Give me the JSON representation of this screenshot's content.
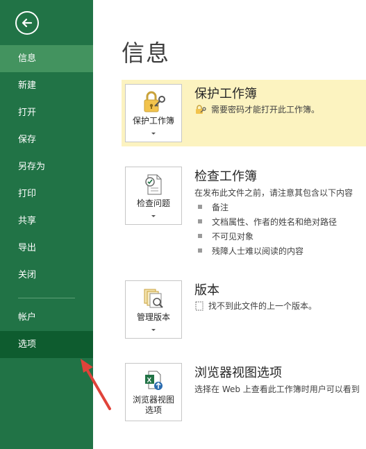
{
  "sidebar": {
    "items": [
      {
        "label": "信息"
      },
      {
        "label": "新建"
      },
      {
        "label": "打开"
      },
      {
        "label": "保存"
      },
      {
        "label": "另存为"
      },
      {
        "label": "打印"
      },
      {
        "label": "共享"
      },
      {
        "label": "导出"
      },
      {
        "label": "关闭"
      },
      {
        "label": "帐户"
      },
      {
        "label": "选项"
      }
    ]
  },
  "main": {
    "title": "信息",
    "protect": {
      "button_label": "保护工作簿",
      "title": "保护工作簿",
      "text": "需要密码才能打开此工作簿。"
    },
    "inspect": {
      "button_label": "检查问题",
      "title": "检查工作簿",
      "text": "在发布此文件之前，请注意其包含以下内容",
      "bullets": [
        "备注",
        "文档属性、作者的姓名和绝对路径",
        "不可见对象",
        "残障人士难以阅读的内容"
      ]
    },
    "versions": {
      "button_label": "管理版本",
      "title": "版本",
      "text": "找不到此文件的上一个版本。"
    },
    "browser": {
      "button_label_1": "浏览器视图",
      "button_label_2": "选项",
      "title": "浏览器视图选项",
      "text": "选择在 Web 上查看此工作簿时用户可以看到"
    }
  },
  "colors": {
    "sidebar": "#217346",
    "sidebar_active": "#43935f",
    "sidebar_selected": "#0e5c2f",
    "highlight": "#fcf3c0",
    "annotation_arrow": "#e0433a"
  }
}
